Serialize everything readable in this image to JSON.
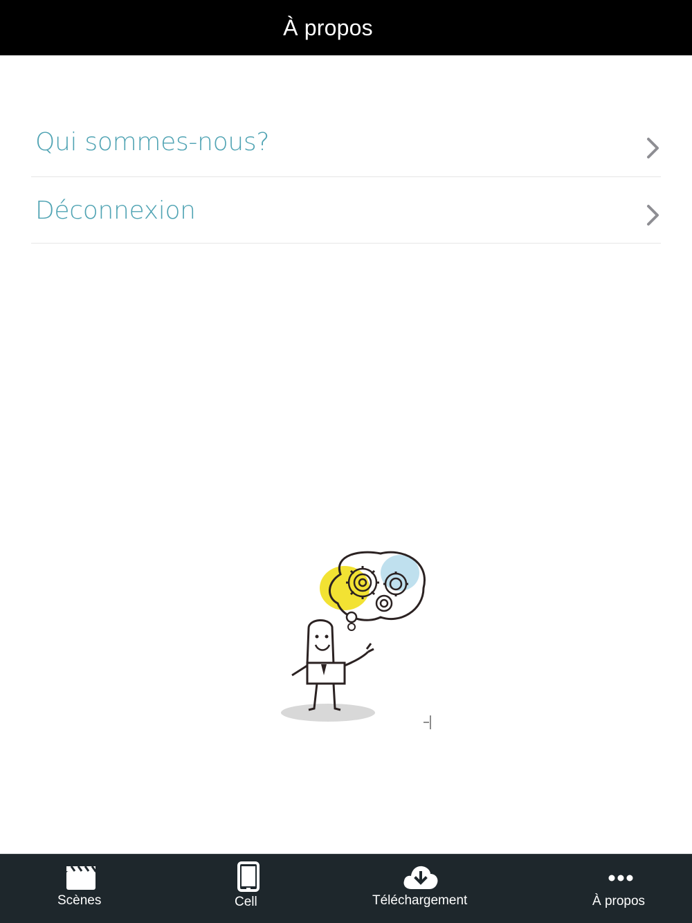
{
  "navbar": {
    "title": "À propos"
  },
  "menu": {
    "items": [
      {
        "label": "Qui sommes-nous?",
        "icon": "chevron-right-icon"
      },
      {
        "label": "Déconnexion",
        "icon": "chevron-right-icon"
      }
    ]
  },
  "illustration": {
    "icon": "thinking-man-gears-illustration"
  },
  "tabbar": {
    "tabs": [
      {
        "label": "Scènes",
        "icon": "clapperboard-icon"
      },
      {
        "label": "Cell",
        "icon": "phone-icon"
      },
      {
        "label": "Téléchargement",
        "icon": "cloud-download-icon"
      },
      {
        "label": "À propos",
        "icon": "more-dots-icon"
      }
    ]
  },
  "colors": {
    "navbar_bg": "#000000",
    "accent_text": "#4fa3b3",
    "tabbar_bg": "#1e272c",
    "chevron": "#8e8e93"
  }
}
